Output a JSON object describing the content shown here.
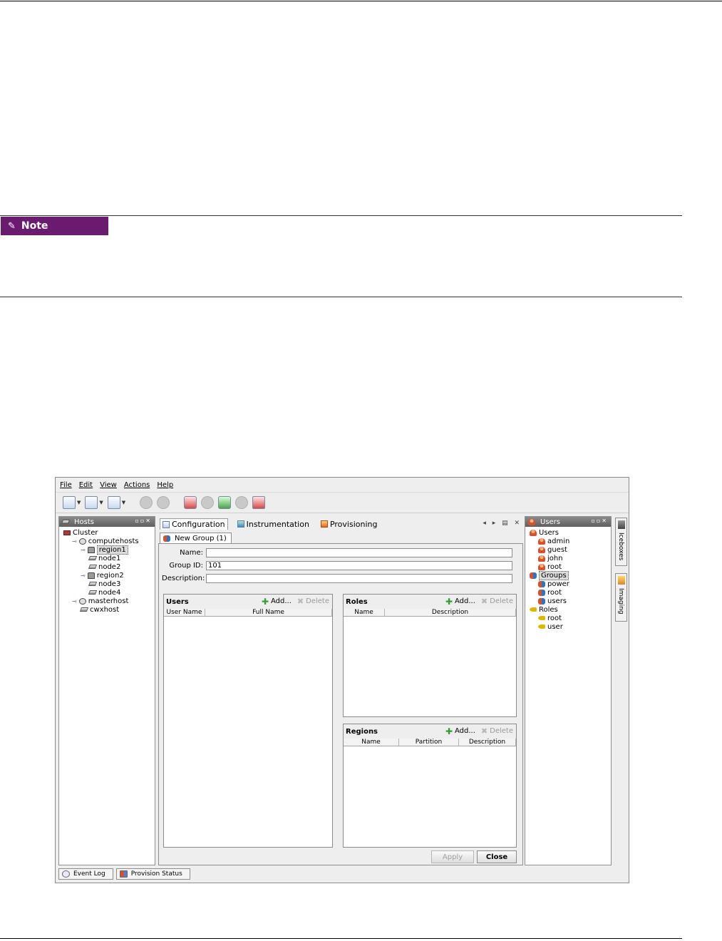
{
  "note": {
    "label": "Note"
  },
  "app": {
    "menu": [
      "File",
      "Edit",
      "View",
      "Actions",
      "Help"
    ],
    "hosts_panel": {
      "title": "Hosts",
      "tree": [
        {
          "label": "Cluster",
          "depth": 0,
          "icon": "cluster-icon"
        },
        {
          "label": "computehosts",
          "depth": 1,
          "icon": "globe-icon"
        },
        {
          "label": "region1",
          "depth": 2,
          "icon": "lock-icon",
          "selected": true
        },
        {
          "label": "node1",
          "depth": 3,
          "icon": "host-icon"
        },
        {
          "label": "node2",
          "depth": 3,
          "icon": "host-icon"
        },
        {
          "label": "region2",
          "depth": 2,
          "icon": "lock-icon"
        },
        {
          "label": "node3",
          "depth": 3,
          "icon": "host-icon"
        },
        {
          "label": "node4",
          "depth": 3,
          "icon": "host-icon"
        },
        {
          "label": "masterhost",
          "depth": 1,
          "icon": "globe-icon"
        },
        {
          "label": "cwxhost",
          "depth": 2,
          "icon": "host-icon"
        }
      ]
    },
    "main_tabs": [
      "Configuration",
      "Instrumentation",
      "Provisioning"
    ],
    "sub_tab": "New Group (1)",
    "form": {
      "name_label": "Name:",
      "name_value": "",
      "group_id_label": "Group ID:",
      "group_id_value": "101",
      "description_label": "Description:",
      "description_value": ""
    },
    "users_table": {
      "title": "Users",
      "add": "Add...",
      "delete": "Delete",
      "columns": [
        "User Name",
        "Full Name"
      ]
    },
    "roles_table": {
      "title": "Roles",
      "add": "Add...",
      "delete": "Delete",
      "columns": [
        "Name",
        "Description"
      ]
    },
    "regions_table": {
      "title": "Regions",
      "add": "Add...",
      "delete": "Delete",
      "columns": [
        "Name",
        "Partition",
        "Description"
      ]
    },
    "buttons": {
      "apply": "Apply",
      "close": "Close"
    },
    "users_panel": {
      "title": "Users",
      "tree": [
        {
          "label": "Users",
          "depth": 0,
          "icon": "user-icon"
        },
        {
          "label": "admin",
          "depth": 1,
          "icon": "user-icon"
        },
        {
          "label": "guest",
          "depth": 1,
          "icon": "user-icon"
        },
        {
          "label": "john",
          "depth": 1,
          "icon": "user-icon"
        },
        {
          "label": "root",
          "depth": 1,
          "icon": "user-icon"
        },
        {
          "label": "Groups",
          "depth": 0,
          "icon": "group-icon",
          "selected": true
        },
        {
          "label": "power",
          "depth": 1,
          "icon": "group-icon"
        },
        {
          "label": "root",
          "depth": 1,
          "icon": "group-icon"
        },
        {
          "label": "users",
          "depth": 1,
          "icon": "group-icon"
        },
        {
          "label": "Roles",
          "depth": 0,
          "icon": "key-icon"
        },
        {
          "label": "root",
          "depth": 1,
          "icon": "key-icon"
        },
        {
          "label": "user",
          "depth": 1,
          "icon": "key-icon"
        }
      ]
    },
    "side_tabs": [
      "Iceboxes",
      "Imaging"
    ],
    "bottom_tabs": [
      "Event Log",
      "Provision Status"
    ]
  }
}
